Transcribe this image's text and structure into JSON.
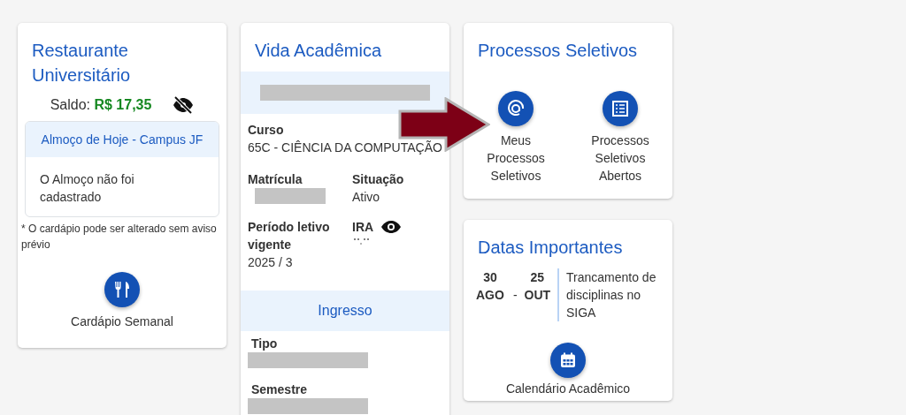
{
  "restaurant": {
    "title": "Restaurante Universitário",
    "balance_label": "Saldo:",
    "balance_value": "R$ 17,35",
    "menu": {
      "header": "Almoço de Hoje - Campus JF",
      "body": "O Almoço não foi cadastrado"
    },
    "note": "* O cardápio pode ser alterado sem aviso prévio",
    "button": "Cardápio Semanal"
  },
  "academic": {
    "title": "Vida Acadêmica",
    "course": {
      "label": "Curso",
      "value": "65C - CIÊNCIA DA COMPUTAÇÃO"
    },
    "fields": [
      {
        "label": "Matrícula",
        "kind": "redacted"
      },
      {
        "label": "Situação",
        "value": "Ativo",
        "kind": "text"
      },
      {
        "label": "Período letivo vigente",
        "value": "2025 / 3",
        "kind": "text"
      },
      {
        "label": "IRA",
        "kind": "hidden-value"
      }
    ],
    "ingresso": {
      "title": "Ingresso",
      "fields": [
        {
          "label": "Tipo",
          "kind": "redacted"
        },
        {
          "label": "Semestre",
          "kind": "redacted"
        }
      ]
    }
  },
  "selection": {
    "title": "Processos Seletivos",
    "buttons": [
      {
        "kind": "target",
        "label": "Meus Processos Seletivos"
      },
      {
        "kind": "list",
        "label": "Processos Seletivos Abertos"
      }
    ]
  },
  "dates": {
    "title": "Datas Importantes",
    "events": [
      {
        "start_day": "30",
        "start_month": "AGO",
        "separator": "-",
        "end_day": "25",
        "end_month": "OUT",
        "text": "Trancamento de disciplinas no SIGA"
      }
    ],
    "button": "Calendário Acadêmico"
  }
}
